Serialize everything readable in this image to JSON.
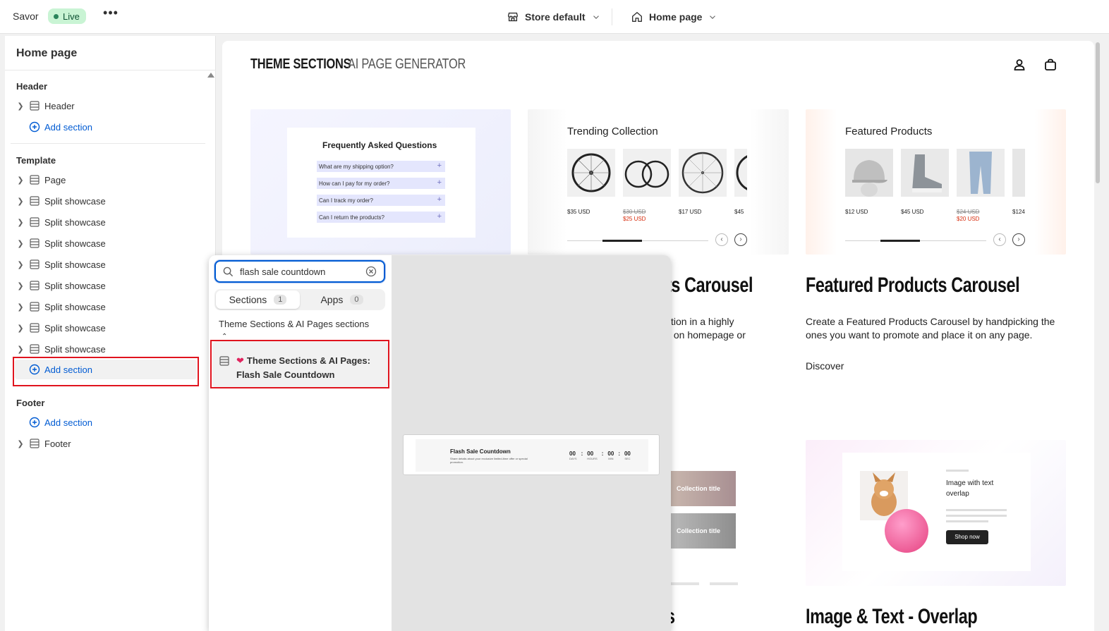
{
  "topbar": {
    "app_name": "Savor",
    "status": "Live",
    "more": "•••",
    "store_selector": "Store default",
    "page_selector": "Home page"
  },
  "sidebar": {
    "title": "Home page",
    "header_group": "Header",
    "header_item": "Header",
    "template_group": "Template",
    "template_items": [
      "Page",
      "Split showcase",
      "Split showcase",
      "Split showcase",
      "Split showcase",
      "Split showcase",
      "Split showcase",
      "Split showcase",
      "Split showcase"
    ],
    "footer_group": "Footer",
    "footer_item": "Footer",
    "add_section": "Add section"
  },
  "preview": {
    "brand_main": "THEME SECTIONS",
    "brand_secondary": "AI PAGE GENERATOR",
    "faq": {
      "title": "Frequently Asked Questions",
      "items": [
        "What are my shipping option?",
        "How can I pay for my order?",
        "Can I track my order?",
        "Can I return the products?"
      ]
    },
    "trending": {
      "heading": "Trending Collection",
      "prices": [
        "$35 USD",
        "$30 USD",
        "$25 USD",
        "$17 USD",
        "$45"
      ]
    },
    "featured": {
      "heading": "Featured Products",
      "prices": [
        "$12 USD",
        "$45 USD",
        "$24 USD",
        "$20 USD",
        "$124"
      ]
    },
    "carousel_title_partial": "ts Carousel",
    "carousel_desc_partial": "tion in a highly\n on homepage or",
    "featured_title": "Featured Products Carousel",
    "featured_desc": "Create a Featured Products Carousel by handpicking the ones you want to promote and place it on any page.",
    "featured_link": "Discover",
    "collection_labels": [
      "Collection title",
      "Collection title"
    ],
    "overlay_card": {
      "text": "Image with text overlap",
      "button": "Shop now"
    },
    "partial_s": "s",
    "overlap_title": "Image & Text - Overlap"
  },
  "popup": {
    "search_value": "flash sale countdown",
    "tabs": [
      {
        "label": "Sections",
        "count": "1"
      },
      {
        "label": "Apps",
        "count": "0"
      }
    ],
    "results_heading": "Theme Sections & AI Pages sections",
    "result_label": "Theme Sections & AI Pages: Flash Sale Countdown",
    "preview_card": {
      "title": "Flash Sale Countdown",
      "subtitle": "Share details about your exclusive limited-time offer or special promotion.",
      "timer_values": [
        "00",
        "00",
        "00",
        "00"
      ],
      "timer_units": [
        "DAYS",
        "HOURS",
        "MIN",
        "SEC"
      ]
    }
  },
  "colors": {
    "accent": "#005bd3",
    "highlight": "#e0141e",
    "live_bg": "#c9f4d4"
  }
}
